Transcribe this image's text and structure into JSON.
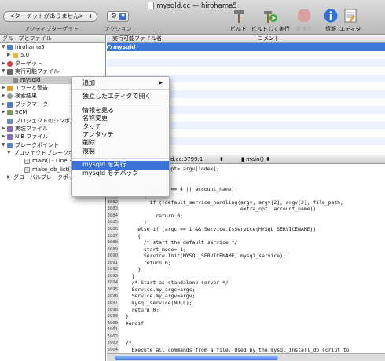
{
  "window": {
    "title": "mysqld.cc — hirohama5"
  },
  "toolbar": {
    "target_popup": "<ターゲットがありません>",
    "target_caption": "アクティブターゲット",
    "action_label": "アクション",
    "build_label": "ビルド",
    "build_run_label": "ビルドして実行",
    "task_label": "タスク",
    "info_label": "情報",
    "editor_label": "エディタ"
  },
  "sidebar": {
    "header": "グループとファイル",
    "items": [
      {
        "label": "hirohama5"
      },
      {
        "label": "5.0"
      },
      {
        "label": "ターゲット"
      },
      {
        "label": "実行可能ファイル"
      },
      {
        "label": "mysqld"
      },
      {
        "label": "エラーと警告"
      },
      {
        "label": "検索結果"
      },
      {
        "label": "ブックマーク"
      },
      {
        "label": "SCM"
      },
      {
        "label": "プロジェクトのシンボル"
      },
      {
        "label": "実装ファイル"
      },
      {
        "label": "NIB ファイル"
      },
      {
        "label": "ブレークポイント"
      },
      {
        "label": "プロジェクトブレークポ"
      },
      {
        "label": "main() - Line 37"
      },
      {
        "label": "make_db_list()"
      },
      {
        "label": "グローバルブレークポイ"
      }
    ]
  },
  "list": {
    "col_name": "実行可能ファイル名",
    "col_comment": "コメント",
    "rows": [
      {
        "name": "mysqld"
      }
    ]
  },
  "navbar": {
    "file_pos": "d.cc:3799:1",
    "function": "main()"
  },
  "context_menu": {
    "items": [
      {
        "label": "追加",
        "submenu": "▶"
      },
      {
        "label": "独立したエディタで開く"
      },
      {
        "label": "情報を見る"
      },
      {
        "label": "名称変更"
      },
      {
        "label": "タッチ"
      },
      {
        "label": "アンタッチ"
      },
      {
        "label": "削除"
      },
      {
        "label": "複製"
      },
      {
        "label": "mysqld を実行"
      },
      {
        "label": "mysqld をデバッグ"
      }
    ]
  },
  "code": {
    "lines": [
      {
        "n": "",
        "t": "               opt= argv[index];"
      },
      {
        "n": "",
        "t": ""
      },
      {
        "n": "",
        "t": ""
      },
      {
        "n": "3880",
        "t": "       if (argc == 4 || account_name)"
      },
      {
        "n": "3881",
        "t": "       {"
      },
      {
        "n": "3882",
        "t": "         if (!default_service_handling(argv, argv[2], argv[3], file_path,"
      },
      {
        "n": "3883",
        "t": "                                       extra_opt, account_name))"
      },
      {
        "n": "3884",
        "t": "           return 0;"
      },
      {
        "n": "3885",
        "t": "       }"
      },
      {
        "n": "3886",
        "t": "     else if (argc == 1 && Service.IsService(MYSQL_SERVICENAME))"
      },
      {
        "n": "3887",
        "t": "     {"
      },
      {
        "n": "3888",
        "t": "       /* start the default service */"
      },
      {
        "n": "3889",
        "t": "       start_mode= 1;"
      },
      {
        "n": "3890",
        "t": "       Service.Init(MYSQL_SERVICENAME, mysql_service);"
      },
      {
        "n": "3891",
        "t": "       return 0;"
      },
      {
        "n": "3892",
        "t": "     }"
      },
      {
        "n": "3893",
        "t": "   }"
      },
      {
        "n": "3894",
        "t": "   /* Start as standalone server */"
      },
      {
        "n": "3895",
        "t": "   Service.my_argc=argc;"
      },
      {
        "n": "3896",
        "t": "   Service.my_argv=argv;"
      },
      {
        "n": "3897",
        "t": "   mysql_service(NULL);"
      },
      {
        "n": "3898",
        "t": "   return 0;"
      },
      {
        "n": "3899",
        "t": " }"
      },
      {
        "n": "3900",
        "t": " #endif"
      },
      {
        "n": "3901",
        "t": ""
      },
      {
        "n": "3902",
        "t": ""
      },
      {
        "n": "3903",
        "t": " /*"
      },
      {
        "n": "3904",
        "t": "   Execute all commands from a file. Used by the mysql_install_db script to"
      },
      {
        "n": "3905",
        "t": ""
      }
    ]
  }
}
